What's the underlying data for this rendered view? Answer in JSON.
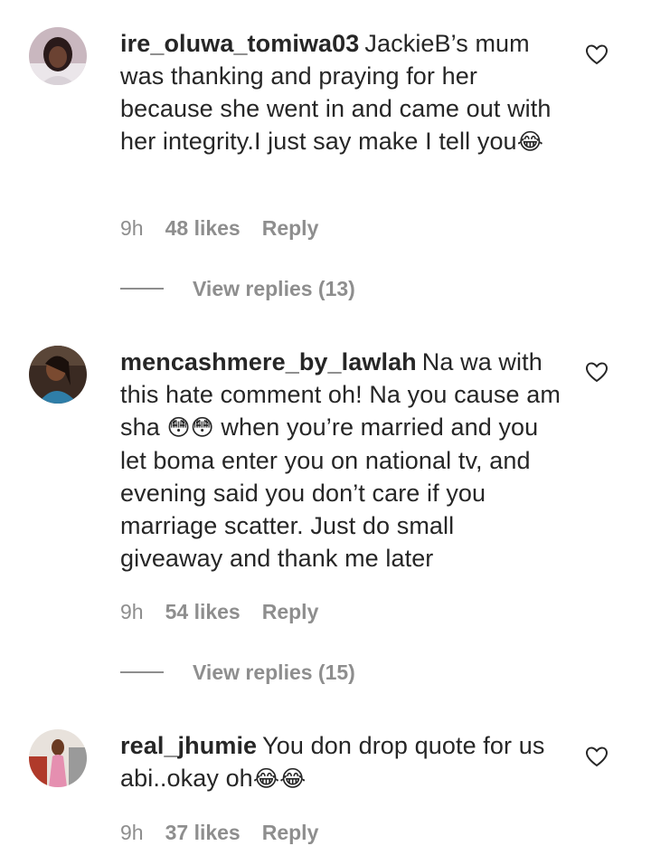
{
  "comments": [
    {
      "username": "ire_oluwa_tomiwa03",
      "text": "JackieB’s mum was thanking and praying for her because she went in and came out with her integrity.I just say make I tell you",
      "emoji": "😂",
      "time": "9h",
      "likes": "48 likes",
      "reply": "Reply",
      "view_replies": "View replies (13)"
    },
    {
      "username": "mencashmere_by_lawlah",
      "text_before": "Na wa with this hate comment oh! Na you cause am sha",
      "emoji_mid": "😳😳",
      "text_after": "when you’re married and you let boma enter you on national tv, and evening said you don’t care if you marriage scatter. Just do small giveaway and thank me later",
      "time": "9h",
      "likes": "54 likes",
      "reply": "Reply",
      "view_replies": "View replies (15)"
    },
    {
      "username": "real_jhumie",
      "text": "You don drop quote for us abi..okay oh",
      "emoji": "😂😂",
      "time": "9h",
      "likes": "37 likes",
      "reply": "Reply"
    }
  ],
  "icons": {
    "like": "heart-outline-icon"
  },
  "colors": {
    "text": "#262626",
    "muted": "#8e8e8e",
    "background": "#ffffff"
  }
}
